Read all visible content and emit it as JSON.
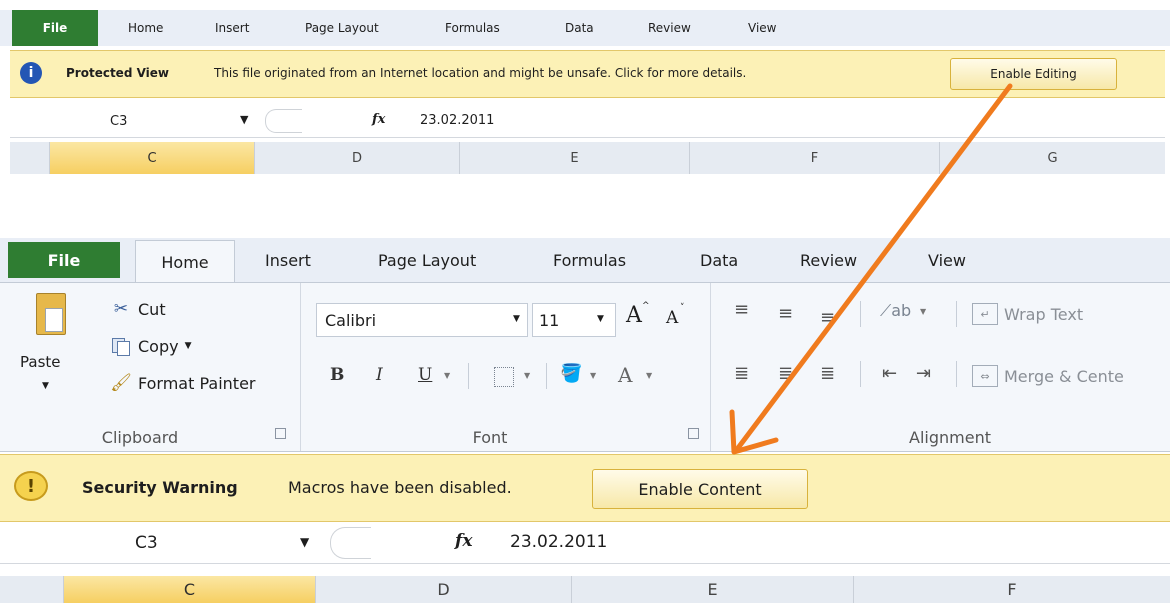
{
  "colors": {
    "file_tab": "#2f7d32",
    "ribbon_bg": "#eef2f8",
    "message_bar": "#fcf1b6",
    "selected_header": "#f8d673",
    "arrow": "#f07b1e"
  },
  "top": {
    "tabs": [
      "File",
      "Home",
      "Insert",
      "Page Layout",
      "Formulas",
      "Data",
      "Review",
      "View"
    ],
    "bar": {
      "icon": "info-icon",
      "title": "Protected View",
      "message": "This file originated from an Internet location and might be unsafe. Click for more details.",
      "button": "Enable Editing"
    },
    "name_box": "C3",
    "fx": "fx",
    "formula": "23.02.2011",
    "columns": [
      "C",
      "D",
      "E",
      "F",
      "G"
    ]
  },
  "bottom": {
    "tabs": [
      "File",
      "Home",
      "Insert",
      "Page Layout",
      "Formulas",
      "Data",
      "Review",
      "View"
    ],
    "clipboard": {
      "paste": "Paste",
      "cut": "Cut",
      "copy": "Copy",
      "format_painter": "Format Painter",
      "group": "Clipboard"
    },
    "font": {
      "name": "Calibri",
      "size": "11",
      "grow": "A",
      "shrink": "A",
      "bold": "B",
      "italic": "I",
      "underline": "U",
      "font_color": "A",
      "group": "Font"
    },
    "alignment": {
      "wrap_text": "Wrap Text",
      "merge": "Merge & Cente",
      "group": "Alignment"
    },
    "bar": {
      "icon": "warning-icon",
      "title": "Security Warning",
      "message": "Macros have been disabled.",
      "button": "Enable Content"
    },
    "name_box": "C3",
    "fx": "fx",
    "formula": "23.02.2011",
    "columns": [
      "C",
      "D",
      "E",
      "F"
    ]
  }
}
